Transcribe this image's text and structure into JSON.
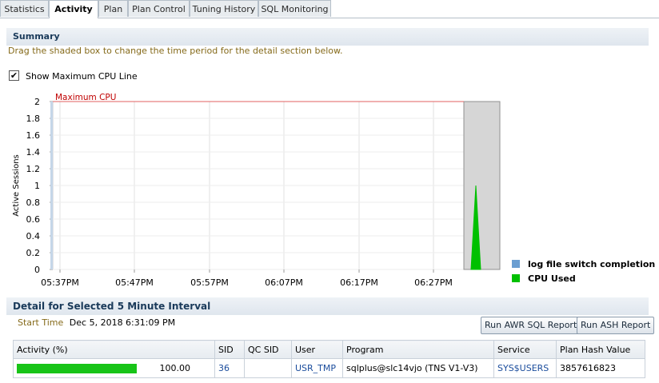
{
  "tabs": [
    {
      "label": "Statistics",
      "active": false
    },
    {
      "label": "Activity",
      "active": true
    },
    {
      "label": "Plan",
      "active": false
    },
    {
      "label": "Plan Control",
      "active": false
    },
    {
      "label": "Tuning History",
      "active": false
    },
    {
      "label": "SQL Monitoring",
      "active": false
    }
  ],
  "summary": {
    "title": "Summary",
    "hint": "Drag the shaded box to change the time period for the detail section below.",
    "checkbox_label": "Show Maximum CPU Line",
    "checkbox_checked": true
  },
  "chart_data": {
    "type": "area",
    "ylabel": "Active Sessions",
    "ylim": [
      0,
      2
    ],
    "yticks": [
      "2",
      "1.8",
      "1.6",
      "1.4",
      "1.2",
      "1",
      "0.8",
      "0.6",
      "0.4",
      "0.2",
      "0"
    ],
    "xticks": [
      "05:37PM",
      "05:47PM",
      "05:57PM",
      "06:07PM",
      "06:17PM",
      "06:27PM"
    ],
    "max_line_label": "Maximum CPU",
    "max_line_value": 2,
    "legend": [
      {
        "name": "log file switch completion",
        "color": "#6b9ed1"
      },
      {
        "name": "CPU Used",
        "color": "#00c000"
      }
    ],
    "series": [
      {
        "name": "CPU Used",
        "color": "#00c000",
        "x": [
          "06:31PM",
          "06:32PM",
          "06:33PM"
        ],
        "values": [
          0,
          1,
          0
        ]
      }
    ],
    "selection_window": "06:28PM – 06:33PM"
  },
  "detail": {
    "title": "Detail for Selected 5 Minute Interval",
    "start_time_label": "Start Time",
    "start_time_value": "Dec 5, 2018 6:31:09 PM",
    "btn_awr": "Run AWR SQL Report",
    "btn_ash": "Run ASH Report",
    "columns": [
      "Activity (%)",
      "SID",
      "QC SID",
      "User",
      "Program",
      "Service",
      "Plan Hash Value"
    ],
    "rows": [
      {
        "activity_pct": "100.00",
        "activity_fraction": 1.0,
        "sid": "36",
        "qc_sid": "",
        "user": "USR_TMP",
        "program": "sqlplus@slc14vjo (TNS V1-V3)",
        "service": "SYS$USERS",
        "plan_hash": "3857616823"
      }
    ]
  }
}
